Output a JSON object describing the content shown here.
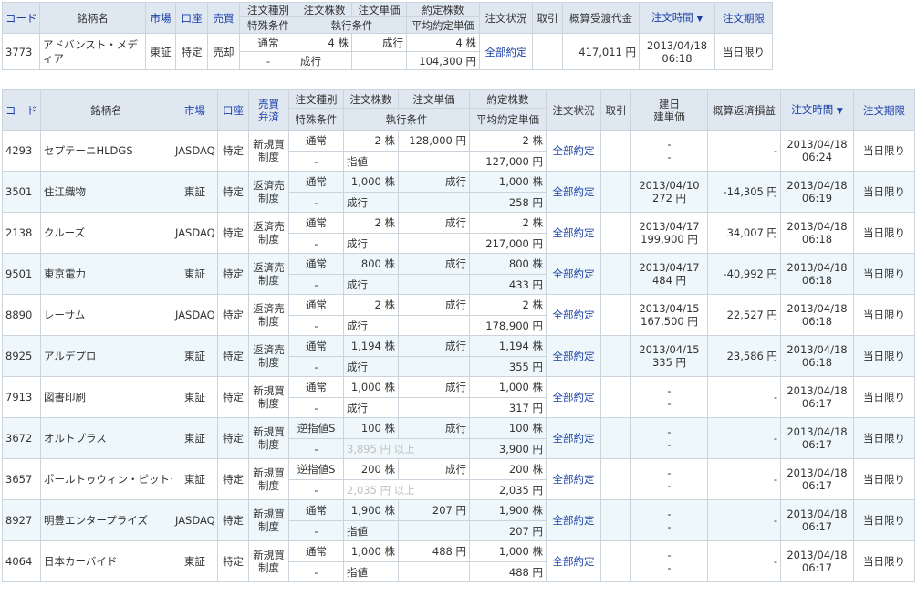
{
  "top": {
    "headers": {
      "code": "コード",
      "name": "銘柄名",
      "market": "市場",
      "account": "口座",
      "side": "売買",
      "order_type": "注文種別",
      "special": "特殊条件",
      "qty": "注文株数",
      "price": "注文単価",
      "exec_cond": "執行条件",
      "filled": "約定株数",
      "avg_price": "平均約定単価",
      "status": "注文状況",
      "cancel": "取引",
      "amount": "概算受渡代金",
      "time": "注文時間",
      "sort_mark": "▼",
      "expiry": "注文期限"
    },
    "row": {
      "code": "3773",
      "name": "アドバンスト・メディア",
      "market": "東証",
      "account": "特定",
      "side": "売却",
      "order_type": "通常",
      "special": "-",
      "qty": "4 株",
      "price": "成行",
      "exec_cond": "成行",
      "filled": "4 株",
      "avg_price": "104,300 円",
      "status": "全部約定",
      "amount": "417,011 円",
      "date": "2013/04/18",
      "time": "06:18",
      "expiry": "当日限り"
    }
  },
  "main": {
    "headers": {
      "code": "コード",
      "name": "銘柄名",
      "market": "市場",
      "account": "口座",
      "side1": "売買",
      "side2": "弁済",
      "order_type": "注文種別",
      "special": "特殊条件",
      "qty": "注文株数",
      "price": "注文単価",
      "exec_cond": "執行条件",
      "filled": "約定株数",
      "avg_price": "平均約定単価",
      "status": "注文状況",
      "cancel": "取引",
      "open1": "建日",
      "open2": "建単価",
      "pl": "概算返済損益",
      "time": "注文時間",
      "sort_mark": "▼",
      "expiry": "注文期限"
    },
    "rows": [
      {
        "code": "4293",
        "name": "セプテーニHLDGS",
        "market": "JASDAQ",
        "account": "特定",
        "side1": "新規買",
        "side2": "制度",
        "order_type": "通常",
        "special": "-",
        "qty": "2 株",
        "price": "128,000 円",
        "exec_cond": "指値",
        "filled": "2 株",
        "avg_price": "127,000 円",
        "status": "全部約定",
        "open_date": "-",
        "open_price": "-",
        "pl": "-",
        "date": "2013/04/18",
        "time": "06:24",
        "expiry": "当日限り"
      },
      {
        "code": "3501",
        "name": "住江織物",
        "market": "東証",
        "account": "特定",
        "side1": "返済売",
        "side2": "制度",
        "order_type": "通常",
        "special": "-",
        "qty": "1,000 株",
        "price": "成行",
        "exec_cond": "成行",
        "filled": "1,000 株",
        "avg_price": "258 円",
        "status": "全部約定",
        "open_date": "2013/04/10",
        "open_price": "272 円",
        "pl": "-14,305 円",
        "date": "2013/04/18",
        "time": "06:19",
        "expiry": "当日限り"
      },
      {
        "code": "2138",
        "name": "クルーズ",
        "market": "JASDAQ",
        "account": "特定",
        "side1": "返済売",
        "side2": "制度",
        "order_type": "通常",
        "special": "-",
        "qty": "2 株",
        "price": "成行",
        "exec_cond": "成行",
        "filled": "2 株",
        "avg_price": "217,000 円",
        "status": "全部約定",
        "open_date": "2013/04/17",
        "open_price": "199,900 円",
        "pl": "34,007 円",
        "date": "2013/04/18",
        "time": "06:18",
        "expiry": "当日限り"
      },
      {
        "code": "9501",
        "name": "東京電力",
        "market": "東証",
        "account": "特定",
        "side1": "返済売",
        "side2": "制度",
        "order_type": "通常",
        "special": "-",
        "qty": "800 株",
        "price": "成行",
        "exec_cond": "成行",
        "filled": "800 株",
        "avg_price": "433 円",
        "status": "全部約定",
        "open_date": "2013/04/17",
        "open_price": "484 円",
        "pl": "-40,992 円",
        "date": "2013/04/18",
        "time": "06:18",
        "expiry": "当日限り"
      },
      {
        "code": "8890",
        "name": "レーサム",
        "market": "JASDAQ",
        "account": "特定",
        "side1": "返済売",
        "side2": "制度",
        "order_type": "通常",
        "special": "-",
        "qty": "2 株",
        "price": "成行",
        "exec_cond": "成行",
        "filled": "2 株",
        "avg_price": "178,900 円",
        "status": "全部約定",
        "open_date": "2013/04/15",
        "open_price": "167,500 円",
        "pl": "22,527 円",
        "date": "2013/04/18",
        "time": "06:18",
        "expiry": "当日限り"
      },
      {
        "code": "8925",
        "name": "アルデプロ",
        "market": "東証",
        "account": "特定",
        "side1": "返済売",
        "side2": "制度",
        "order_type": "通常",
        "special": "-",
        "qty": "1,194 株",
        "price": "成行",
        "exec_cond": "成行",
        "filled": "1,194 株",
        "avg_price": "355 円",
        "status": "全部約定",
        "open_date": "2013/04/15",
        "open_price": "335 円",
        "pl": "23,586 円",
        "date": "2013/04/18",
        "time": "06:18",
        "expiry": "当日限り"
      },
      {
        "code": "7913",
        "name": "図書印刷",
        "market": "東証",
        "account": "特定",
        "side1": "新規買",
        "side2": "制度",
        "order_type": "通常",
        "special": "-",
        "qty": "1,000 株",
        "price": "成行",
        "exec_cond": "成行",
        "filled": "1,000 株",
        "avg_price": "317 円",
        "status": "全部約定",
        "open_date": "-",
        "open_price": "-",
        "pl": "-",
        "date": "2013/04/18",
        "time": "06:17",
        "expiry": "当日限り"
      },
      {
        "code": "3672",
        "name": "オルトプラス",
        "market": "東証",
        "account": "特定",
        "side1": "新規買",
        "side2": "制度",
        "order_type": "逆指値S",
        "special": "-",
        "qty": "100 株",
        "price": "成行",
        "exec_cond": "3,895 円 以上",
        "exec_gray": true,
        "filled": "100 株",
        "avg_price": "3,900 円",
        "status": "全部約定",
        "open_date": "-",
        "open_price": "-",
        "pl": "-",
        "date": "2013/04/18",
        "time": "06:17",
        "expiry": "当日限り"
      },
      {
        "code": "3657",
        "name": "ポールトゥウィン・ピットクル",
        "market": "東証",
        "account": "特定",
        "side1": "新規買",
        "side2": "制度",
        "order_type": "逆指値S",
        "special": "-",
        "qty": "200 株",
        "price": "成行",
        "exec_cond": "2,035 円 以上",
        "exec_gray": true,
        "filled": "200 株",
        "avg_price": "2,035 円",
        "status": "全部約定",
        "open_date": "-",
        "open_price": "-",
        "pl": "-",
        "date": "2013/04/18",
        "time": "06:17",
        "expiry": "当日限り"
      },
      {
        "code": "8927",
        "name": "明豊エンタープライズ",
        "market": "JASDAQ",
        "account": "特定",
        "side1": "新規買",
        "side2": "制度",
        "order_type": "通常",
        "special": "-",
        "qty": "1,900 株",
        "price": "207 円",
        "exec_cond": "指値",
        "filled": "1,900 株",
        "avg_price": "207 円",
        "status": "全部約定",
        "open_date": "-",
        "open_price": "-",
        "pl": "-",
        "date": "2013/04/18",
        "time": "06:17",
        "expiry": "当日限り"
      },
      {
        "code": "4064",
        "name": "日本カーバイド",
        "market": "東証",
        "account": "特定",
        "side1": "新規買",
        "side2": "制度",
        "order_type": "通常",
        "special": "-",
        "qty": "1,000 株",
        "price": "488 円",
        "exec_cond": "指値",
        "filled": "1,000 株",
        "avg_price": "488 円",
        "status": "全部約定",
        "open_date": "-",
        "open_price": "-",
        "pl": "-",
        "date": "2013/04/18",
        "time": "06:17",
        "expiry": "当日限り"
      }
    ]
  }
}
